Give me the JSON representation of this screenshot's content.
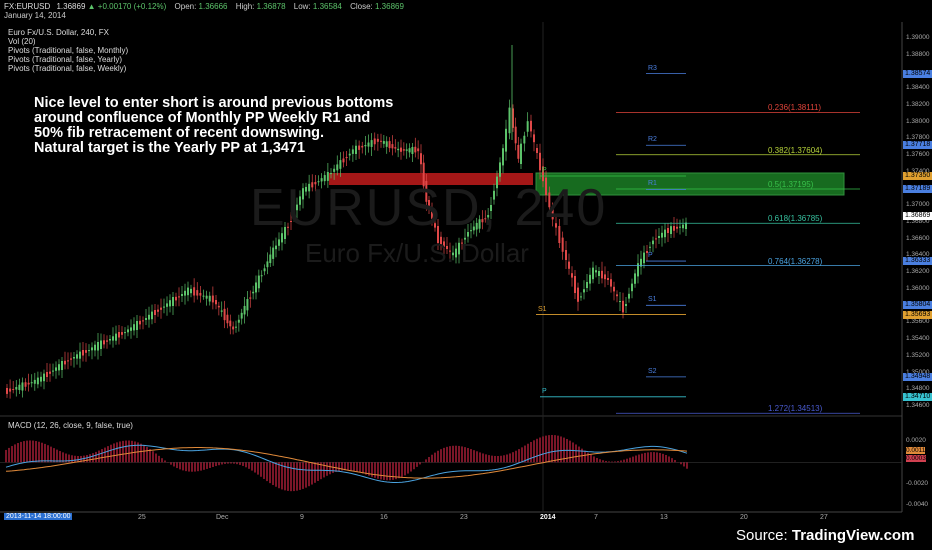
{
  "header": {
    "symbol": "FX:EURUSD",
    "price": "1.36869",
    "change": "+0.00170 (+0.12%)",
    "open_label": "Open:",
    "open": "1.36666",
    "high_label": "High:",
    "high": "1.36878",
    "low_label": "Low:",
    "low": "1.36584",
    "close_label": "Close:",
    "close": "1.36869",
    "date": "January 14, 2014"
  },
  "legend": [
    "Euro Fx/U.S. Dollar, 240, FX",
    "Vol (20)",
    "Pivots (Traditional, false, Monthly)",
    "Pivots (Traditional, false, Yearly)",
    "Pivots (Traditional, false, Weekly)"
  ],
  "annotation": [
    "Nice level to enter short is around previous bottoms",
    "around confluence of Monthly PP Weekly R1 and",
    "50% fib retracement of recent downswing.",
    "Natural target is the Yearly PP at 1,3471"
  ],
  "watermark": {
    "symbol": "EURUSD, 240",
    "name": "Euro Fx/U.S. Dollar"
  },
  "fib_labels": [
    {
      "text": "0.236(1.38111)",
      "color": "#e0443a",
      "price": 1.38111
    },
    {
      "text": "0.382(1.37604)",
      "color": "#b7d33a",
      "price": 1.37604
    },
    {
      "text": "0.5(1.37195)",
      "color": "#37c24a",
      "price": 1.37195
    },
    {
      "text": "0.618(1.36785)",
      "color": "#37c2a0",
      "price": 1.36785
    },
    {
      "text": "0.764(1.36278)",
      "color": "#4aa3e0",
      "price": 1.36278
    },
    {
      "text": "1.272(1.34513)",
      "color": "#4a5bd0",
      "price": 1.34513
    }
  ],
  "pivot_labels": [
    {
      "text": "R3",
      "color": "#4a7fe0",
      "price": 1.38574
    },
    {
      "text": "R2",
      "color": "#4a7fe0",
      "price": 1.37718
    },
    {
      "text": "R1",
      "color": "#4a7fe0",
      "price": 1.37189
    },
    {
      "text": "P",
      "color": "#37c24a",
      "price": 1.3735
    },
    {
      "text": "P",
      "color": "#4a7fe0",
      "price": 1.36333
    },
    {
      "text": "S1",
      "color": "#4a7fe0",
      "price": 1.35804
    },
    {
      "text": "S1",
      "color": "#e0a030",
      "price": 1.35693
    },
    {
      "text": "S2",
      "color": "#4a7fe0",
      "price": 1.34948
    },
    {
      "text": "P",
      "color": "#37c2d0",
      "price": 1.3471
    }
  ],
  "price_tags": [
    {
      "text": "1.38574",
      "color": "#4a7fe0"
    },
    {
      "text": "1.37718",
      "color": "#4a7fe0"
    },
    {
      "text": "1.37350",
      "color": "#e0a030"
    },
    {
      "text": "1.37189",
      "color": "#4a7fe0"
    },
    {
      "text": "1.36869",
      "color": "#ffffff"
    },
    {
      "text": "1.36333",
      "color": "#4a7fe0"
    },
    {
      "text": "1.35804",
      "color": "#4a7fe0"
    },
    {
      "text": "1.35693",
      "color": "#e0a030"
    },
    {
      "text": "1.34948",
      "color": "#4a7fe0"
    },
    {
      "text": "1.34710",
      "color": "#37c2d0"
    }
  ],
  "y_axis": [
    "1.39000",
    "1.38800",
    "1.38400",
    "1.38200",
    "1.38000",
    "1.37800",
    "1.37600",
    "1.37400",
    "1.37000",
    "1.36800",
    "1.36600",
    "1.36400",
    "1.36200",
    "1.36000",
    "1.35800",
    "1.35600",
    "1.35400",
    "1.35200",
    "1.35000",
    "1.34800",
    "1.34600"
  ],
  "macd_axis": [
    "0.0020",
    "0.0011",
    "0.0003",
    "-0.0020",
    "-0.0040"
  ],
  "macd_label": "MACD (12, 26, close, 9, false, true)",
  "x_axis": [
    "25",
    "Dec",
    "9",
    "16",
    "23",
    "2014",
    "7",
    "13",
    "20",
    "27"
  ],
  "date_start": "2013-11-14 18:00:00",
  "source": {
    "prefix": "Source: ",
    "brand": "TradingView.com"
  },
  "colors": {
    "up": "#5cc36a",
    "down": "#e04848",
    "resistance_zone": "#c11b1b",
    "support_zone": "#1f8f2a",
    "macd": "#4aa3e0",
    "signal": "#e08a3a"
  }
}
